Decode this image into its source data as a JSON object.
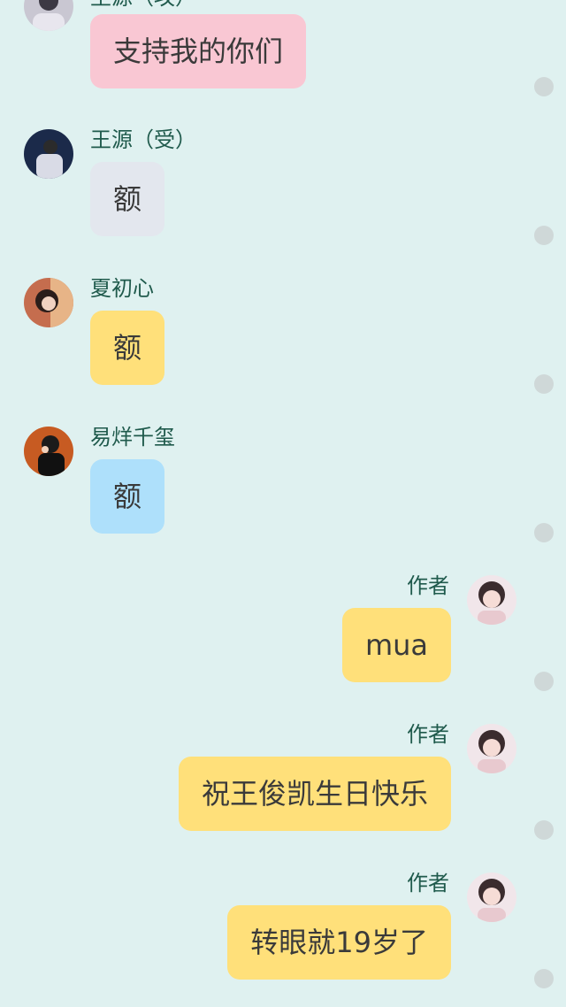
{
  "messages": [
    {
      "side": "left",
      "name": "王源（攻）",
      "text": "支持我的你们",
      "bubble_color": "#f9c7d3",
      "avatar": "avatar-icon"
    },
    {
      "side": "left",
      "name": "王源（受）",
      "text": "额",
      "bubble_color": "#e3e7ee",
      "avatar": "avatar-icon"
    },
    {
      "side": "left",
      "name": "夏初心",
      "text": "额",
      "bubble_color": "#ffe07a",
      "avatar": "avatar-icon"
    },
    {
      "side": "left",
      "name": "易烊千玺",
      "text": "额",
      "bubble_color": "#aee0fb",
      "avatar": "avatar-icon"
    },
    {
      "side": "right",
      "name": "作者",
      "text": "mua",
      "bubble_color": "#ffe07a",
      "avatar": "avatar-icon"
    },
    {
      "side": "right",
      "name": "作者",
      "text": "祝王俊凯生日快乐",
      "bubble_color": "#ffe07a",
      "avatar": "avatar-icon"
    },
    {
      "side": "right",
      "name": "作者",
      "text": "转眼就19岁了",
      "bubble_color": "#ffe07a",
      "avatar": "avatar-icon"
    }
  ]
}
